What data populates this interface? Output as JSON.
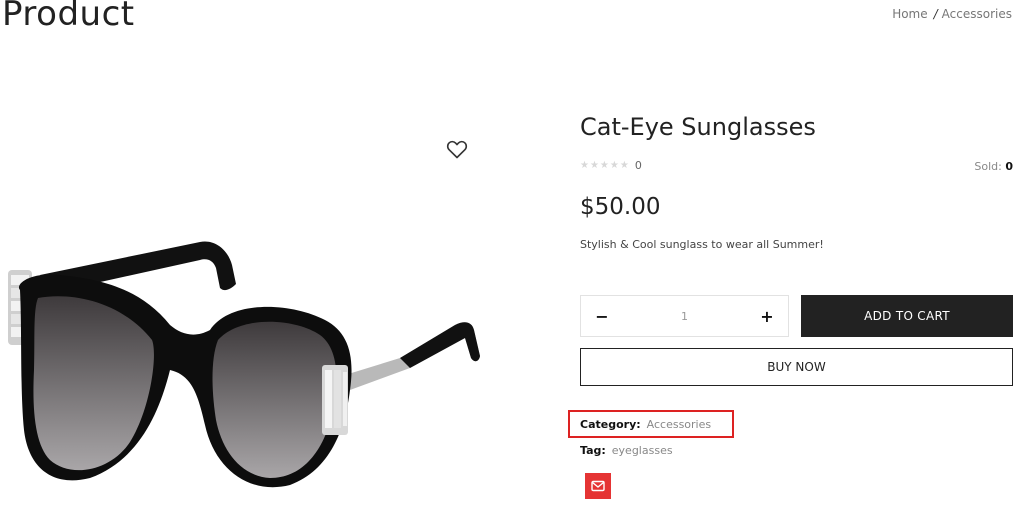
{
  "page": {
    "title": "Product"
  },
  "breadcrumb": {
    "home": "Home",
    "separator": "/",
    "current": "Accessories"
  },
  "product": {
    "name": "Cat-Eye Sunglasses",
    "rating_stars": "★★★★★",
    "rating_count": "0",
    "sold_label": "Sold:",
    "sold_value": "0",
    "price": "$50.00",
    "description": "Stylish & Cool sunglass to wear all Summer!",
    "image_icon": "sunglasses-image"
  },
  "quantity": {
    "decrement": "−",
    "value": "1",
    "increment": "+"
  },
  "actions": {
    "add_to_cart": "ADD TO CART",
    "buy_now": "BUY NOW",
    "wishlist_icon": "heart-icon",
    "share_icon": "email-icon"
  },
  "meta": {
    "category_label": "Category:",
    "category_value": "Accessories",
    "tag_label": "Tag:",
    "tag_value": "eyeglasses"
  },
  "colors": {
    "cart_button": "#222222",
    "share_button": "#e53434",
    "highlight": "#dd2222"
  }
}
